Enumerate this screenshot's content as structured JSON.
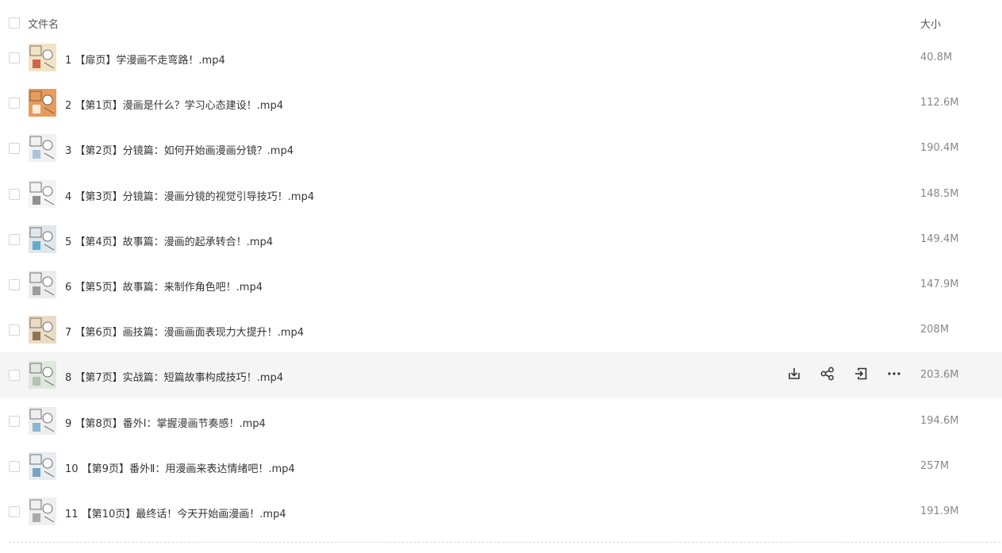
{
  "header": {
    "name_label": "文件名",
    "size_label": "大小"
  },
  "files": [
    {
      "index": "1",
      "name": "1 【扉页】学漫画不走弯路！.mp4",
      "size": "40.8M",
      "thumb_color": "#f2e3c6",
      "thumb_accent": "#c9462c"
    },
    {
      "index": "2",
      "name": "2 【第1页】漫画是什么？学习心态建设！.mp4",
      "size": "112.6M",
      "thumb_color": "#e89b5a",
      "thumb_accent": "#ffffff"
    },
    {
      "index": "3",
      "name": "3 【第2页】分镜篇：如何开始画漫画分镜？.mp4",
      "size": "190.4M",
      "thumb_color": "#f0f0f0",
      "thumb_accent": "#9ab6d6"
    },
    {
      "index": "4",
      "name": "4 【第3页】分镜篇：漫画分镜的视觉引导技巧！.mp4",
      "size": "148.5M",
      "thumb_color": "#f4f4f4",
      "thumb_accent": "#777777"
    },
    {
      "index": "5",
      "name": "5 【第4页】故事篇：漫画的起承转合！.mp4",
      "size": "149.4M",
      "thumb_color": "#dfe6ec",
      "thumb_accent": "#3fa0c9"
    },
    {
      "index": "6",
      "name": "6 【第5页】故事篇：来制作角色吧！.mp4",
      "size": "147.9M",
      "thumb_color": "#ececec",
      "thumb_accent": "#888888"
    },
    {
      "index": "7",
      "name": "7 【第6页】画技篇：漫画画面表现力大提升！.mp4",
      "size": "208M",
      "thumb_color": "#e9dcc4",
      "thumb_accent": "#7a5a3a"
    },
    {
      "index": "8",
      "name": "8 【第7页】实战篇：短篇故事构成技巧！.mp4",
      "size": "203.6M",
      "thumb_color": "#dfe7df",
      "thumb_accent": "#a9b8a9"
    },
    {
      "index": "9",
      "name": "9 【第8页】番外Ⅰ：掌握漫画节奏感！.mp4",
      "size": "194.6M",
      "thumb_color": "#eeeeee",
      "thumb_accent": "#6fa8c9"
    },
    {
      "index": "10",
      "name": "10 【第9页】番外Ⅱ：用漫画来表达情绪吧！.mp4",
      "size": "257M",
      "thumb_color": "#e8edf2",
      "thumb_accent": "#5d8fb8"
    },
    {
      "index": "11",
      "name": "11 【第10页】最终话！今天开始画漫画！.mp4",
      "size": "191.9M",
      "thumb_color": "#efefef",
      "thumb_accent": "#999999"
    }
  ],
  "hovered_row": 8,
  "row_actions": [
    {
      "icon": "download-icon",
      "label": "下载"
    },
    {
      "icon": "share-icon",
      "label": "分享"
    },
    {
      "icon": "move-to-icon",
      "label": "移动到"
    },
    {
      "icon": "more-icon",
      "label": "更多"
    }
  ],
  "colors": {
    "hover_row_bg": "#f5f5f5",
    "text_primary": "#333333",
    "text_secondary": "#888888",
    "icon_color": "#333333"
  }
}
